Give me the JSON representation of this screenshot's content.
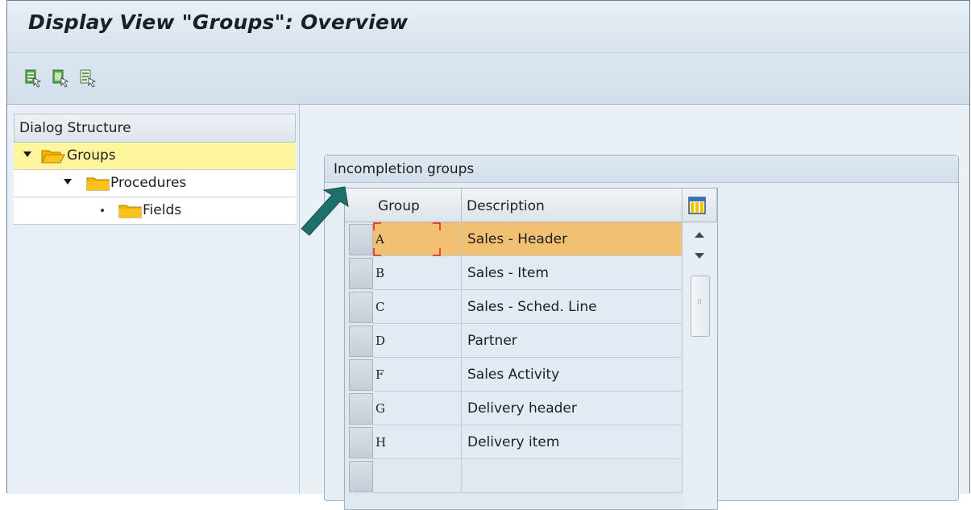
{
  "window": {
    "title": "Display View \"Groups\": Overview"
  },
  "toolbar": {
    "buttons": [
      {
        "name": "expand-icon",
        "color": "#3f9a3a"
      },
      {
        "name": "collapse-icon",
        "color": "#3f9a3a"
      },
      {
        "name": "select-icon",
        "color": "#3f9a3a"
      }
    ]
  },
  "dialog_structure": {
    "header": "Dialog Structure",
    "items": [
      {
        "label": "Groups",
        "selected": true,
        "expanded": true,
        "level": 0
      },
      {
        "label": "Procedures",
        "selected": false,
        "expanded": true,
        "level": 1
      },
      {
        "label": "Fields",
        "selected": false,
        "expanded": false,
        "level": 2
      }
    ]
  },
  "incompletion_groups": {
    "title": "Incompletion groups",
    "columns": [
      "Group",
      "Description"
    ],
    "rows": [
      {
        "group": "A",
        "description": "Sales - Header",
        "highlighted": true
      },
      {
        "group": "B",
        "description": "Sales - Item",
        "highlighted": false
      },
      {
        "group": "C",
        "description": "Sales - Sched. Line",
        "highlighted": false
      },
      {
        "group": "D",
        "description": "Partner",
        "highlighted": false
      },
      {
        "group": "F",
        "description": "Sales Activity",
        "highlighted": false
      },
      {
        "group": "G",
        "description": "Delivery header",
        "highlighted": false
      },
      {
        "group": "H",
        "description": "Delivery item",
        "highlighted": false
      },
      {
        "group": "",
        "description": "",
        "highlighted": false
      }
    ]
  },
  "colors": {
    "selected_tree_row": "#fef69d",
    "highlighted_row": "#f1c070",
    "annotation_arrow": "#1f6f6d",
    "folder": "#f5b400"
  }
}
